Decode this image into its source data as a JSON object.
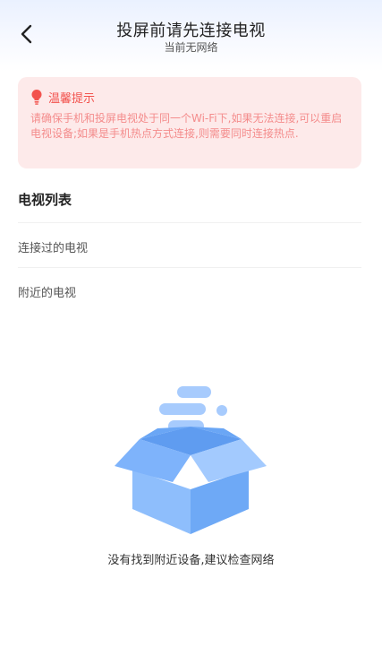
{
  "header": {
    "title": "投屏前请先连接电视",
    "subtitle": "当前无网络"
  },
  "tip": {
    "title": "温馨提示",
    "body": "请确保手机和投屏电视处于同一个Wi-Fi下,如果无法连接,可以重启电视设备;如果是手机热点方式连接,则需要同时连接热点."
  },
  "tv_list": {
    "title": "电视列表",
    "items": [
      {
        "label": "连接过的电视"
      },
      {
        "label": "附近的电视"
      }
    ]
  },
  "empty_state": {
    "message": "没有找到附近设备,建议检查网络"
  },
  "colors": {
    "tip_title": "#f2534e",
    "tip_text": "#f48c8c",
    "tip_background": "#fdeaea",
    "box_blue": "#7eb3fb"
  },
  "icons": {
    "back": "chevron-left-icon",
    "tip": "lightbulb-icon",
    "empty": "open-box-icon"
  }
}
